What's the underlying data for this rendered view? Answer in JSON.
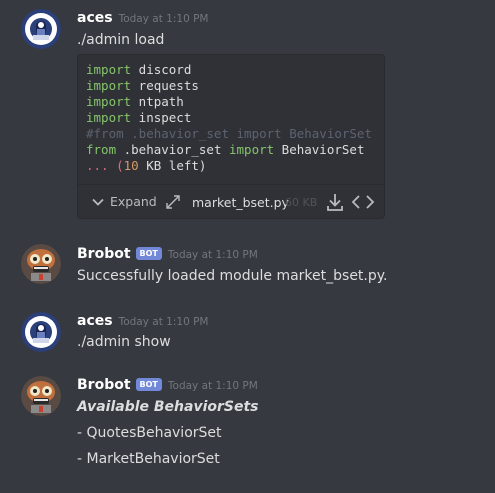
{
  "messages": [
    {
      "author": "aces",
      "timestamp": "Today at 1:10 PM",
      "content": "./admin load",
      "attachment": {
        "code_lines": [
          {
            "kw": "import",
            "rest": " discord"
          },
          {
            "kw": "import",
            "rest": " requests"
          },
          {
            "kw": "import",
            "rest": " ntpath"
          },
          {
            "kw": "import",
            "rest": " inspect"
          }
        ],
        "comment_line": "#from .behavior_set import BehaviorSet",
        "from_line": {
          "kw1": "from",
          "mod": " .behavior_set ",
          "kw2": "import",
          "rest": " BehaviorSet"
        },
        "remaining": {
          "prefix": "... (",
          "num": "10",
          "suffix": " KB left)"
        },
        "expand_label": "Expand",
        "filename": "market_bset.py",
        "filesize": "60 KB"
      }
    },
    {
      "author": "Brobot",
      "badge": "BOT",
      "timestamp": "Today at 1:10 PM",
      "content": "Successfully loaded module market_bset.py."
    },
    {
      "author": "aces",
      "timestamp": "Today at 1:10 PM",
      "content": "./admin show"
    },
    {
      "author": "Brobot",
      "badge": "BOT",
      "timestamp": "Today at 1:10 PM",
      "heading": "Available BehaviorSets",
      "lines": [
        "- QuotesBehaviorSet",
        "- MarketBehaviorSet"
      ]
    }
  ],
  "colors": {
    "background": "#36393f",
    "attachment_bg": "#2f3136",
    "bot_badge": "#7289da",
    "keyword": "#85c46c",
    "timestamp": "#72767d"
  },
  "icons": {
    "aces_avatar": "astronaut-avatar-icon",
    "brobot_avatar": "robot-avatar-icon",
    "expand": "chevron-down-icon",
    "collapse": "diagonal-arrows-icon",
    "download": "download-icon",
    "code": "code-brackets-icon"
  }
}
